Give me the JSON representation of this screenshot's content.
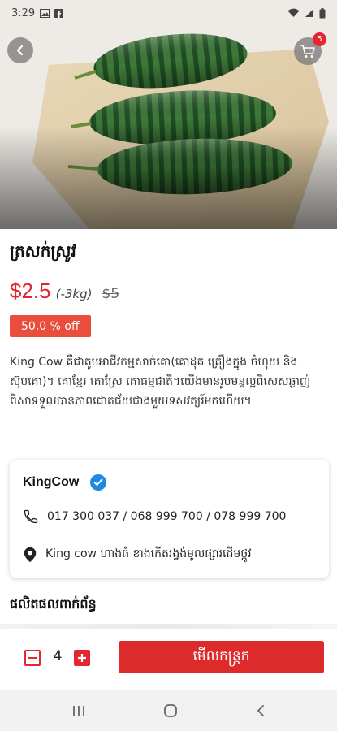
{
  "status_bar": {
    "time": "3:29"
  },
  "header": {
    "cart_count": "5"
  },
  "product": {
    "title": "ត្រសក់ស្រូវ",
    "price": "$2.5",
    "unit": "(-3kg)",
    "old_price": "$5",
    "discount": "50.0 % off",
    "description": "King Cow គឺជាតូបអាជីវកម្មសាច់គោ(គោដុត គ្រឿងក្នុង ចំហុយ និងស៊ុបគោ)។ គោខ្មែរ គោស្រែ គោធម្មជាតិ។យើងមានរូបមន្តល្អពិសេសឆ្ងាញ់ពិសាទទួលបានភាពជោគជ័យជាងមួយទសវត្សរ៍មកហើយ។"
  },
  "shop": {
    "name": "KingCow",
    "phone": "017 300 037 / 068 999 700 / 078 999 700",
    "address": "King cow ហាងធំ ខាងកើតរង្វង់មូលផ្សារដើមថ្កូវ"
  },
  "related": {
    "title": "ផលិតផលពាក់ព័ន្ធ"
  },
  "cart_bar": {
    "quantity": "4",
    "order_label": "មើលកន្ត្រក"
  },
  "colors": {
    "accent": "#e3262f",
    "discount_bg": "#e94d3c",
    "verified": "#1e88e5"
  }
}
